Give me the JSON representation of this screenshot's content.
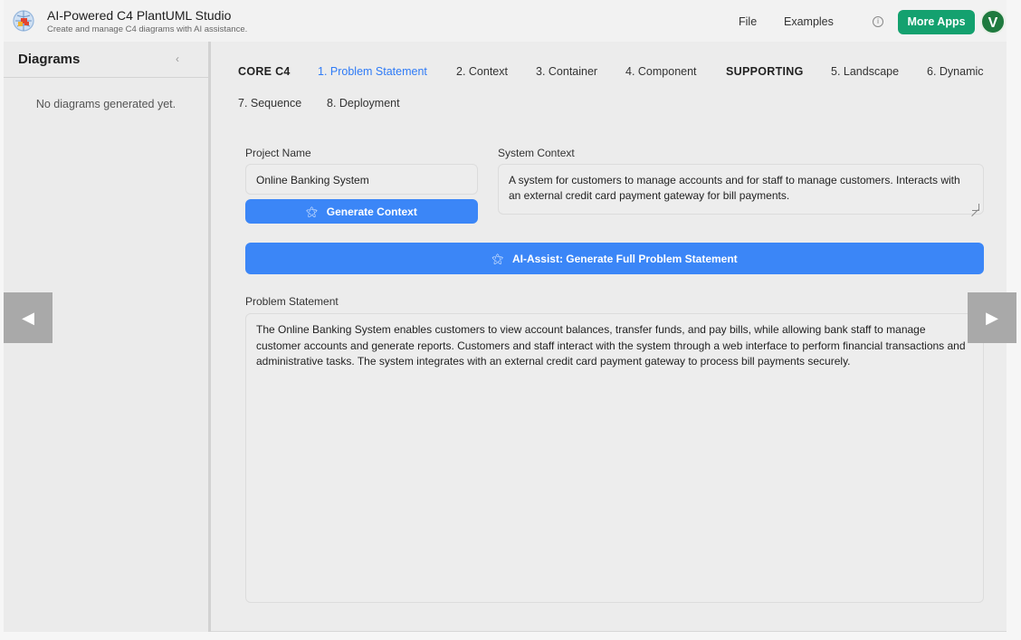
{
  "header": {
    "title": "AI-Powered C4 PlantUML Studio",
    "subtitle": "Create and manage C4 diagrams with AI assistance.",
    "menu_file": "File",
    "menu_examples": "Examples",
    "info_glyph": "i",
    "more_apps": "More Apps",
    "avatar_letter": "V"
  },
  "sidebar": {
    "title": "Diagrams",
    "collapse_glyph": "‹",
    "empty_message": "No diagrams generated yet."
  },
  "tabs": {
    "core_group": "CORE C4",
    "problem_statement": "1. Problem Statement",
    "context": "2. Context",
    "container": "3. Container",
    "component": "4. Component",
    "supporting_group": "SUPPORTING",
    "landscape": "5. Landscape",
    "dynamic": "6. Dynamic",
    "sequence": "7. Sequence",
    "deployment": "8. Deployment",
    "active": "1. Problem Statement"
  },
  "form": {
    "project_name_label": "Project Name",
    "project_name_value": "Online Banking System",
    "system_context_label": "System Context",
    "system_context_value": "A system for customers to manage accounts and for staff to manage customers. Interacts with an external credit card payment gateway for bill payments.",
    "generate_context_label": "Generate Context",
    "full_problem_label": "AI-Assist: Generate Full Problem Statement",
    "problem_statement_label": "Problem Statement",
    "problem_statement_value": "The Online Banking System enables customers to view account balances, transfer funds, and pay bills, while allowing bank staff to manage customer accounts and generate reports. Customers and staff interact with the system through a web interface to perform financial transactions and administrative tasks. The system integrates with an external credit card payment gateway to process bill payments securely."
  },
  "nav": {
    "prev_glyph": "◀",
    "next_glyph": "▶"
  },
  "colors": {
    "accent_blue": "#3b86f7",
    "active_tab": "#2f7bf6",
    "more_apps_green": "#14a16f",
    "avatar_green": "#1f7a3f"
  },
  "icons": {
    "logo": "globe-puzzle-logo-icon",
    "wand": "magic-wand-icon",
    "info": "info-circle-icon"
  }
}
